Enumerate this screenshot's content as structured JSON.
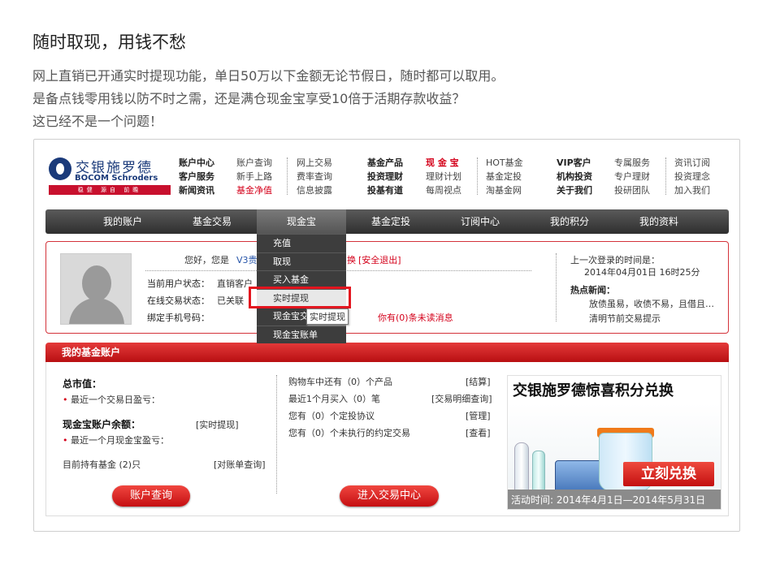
{
  "intro": {
    "title": "随时取现，用钱不愁",
    "lines": [
      "网上直销已开通实时提现功能，单日50万以下金额无论节假日，随时都可以取用。",
      "是备点钱零用钱以防不时之需，还是满仓现金宝享受10倍于活期存款收益？",
      "这已经不是一个问题！"
    ]
  },
  "logo": {
    "cn": "交银施罗德",
    "en": "BOCOM Schroders",
    "slogan": "稳健 源自 前瞻"
  },
  "header_links": {
    "col1": [
      "账户中心",
      "客户服务",
      "新闻资讯"
    ],
    "col2": [
      "账户查询",
      "新手上路",
      "基金净值"
    ],
    "col3": [
      "网上交易",
      "费率查询",
      "信息披露"
    ],
    "col4": [
      "基金产品",
      "投资理财",
      "投基有道"
    ],
    "col5": [
      "现 金 宝",
      "理财计划",
      "每周视点"
    ],
    "col6": [
      "HOT基金",
      "基金定投",
      "淘基金网"
    ],
    "col7": [
      "VIP客户",
      "机构投资",
      "关于我们"
    ],
    "col8": [
      "专属服务",
      "专户理财",
      "投研团队"
    ],
    "col9": [
      "资讯订阅",
      "投资理念",
      "加入我们"
    ]
  },
  "nav": [
    "我的账户",
    "基金交易",
    "现金宝",
    "基金定投",
    "订阅中心",
    "我的积分",
    "我的资料"
  ],
  "dropdown": [
    "充值",
    "取现",
    "买入基金",
    "实时提现",
    "现金宝交",
    "现金宝账单"
  ],
  "tooltip": "实时提现",
  "account": {
    "greeting": "您好，您是",
    "vip": "V3贵宾客",
    "hidden_suffix": "换",
    "logout": "[安全退出]",
    "status_label": "当前用户状态：",
    "status_value": "直销客户",
    "trade_label": "在线交易状态：",
    "trade_value": "已关联",
    "phone_label": "绑定手机号码：",
    "unread": "你有(0)条未读消息",
    "last_login_label": "上一次登录的时间是：",
    "last_login_time": "2014年04月01日 16时25分",
    "news_label": "热点新闻：",
    "news": [
      "放债虽易，收债不易，且借且…",
      "清明节前交易提示"
    ]
  },
  "fund": {
    "header": "我的基金账户",
    "total_label": "总市值：",
    "total_sub": "最近一个交易日盈亏：",
    "cash_label": "现金宝账户余额：",
    "cash_link": "[实时提现]",
    "cash_sub": "最近一个月现金宝盈亏：",
    "holding": "目前持有基金 (2)只",
    "holding_link": "[对账单查询]",
    "rows": [
      {
        "text": "购物车中还有（0）个产品",
        "link": "[结算]"
      },
      {
        "text": "最近1个月买入（0）笔",
        "link": "[交易明细查询]"
      },
      {
        "text": "您有（0）个定投协议",
        "link": "[管理]"
      },
      {
        "text": "您有（0）个未执行的约定交易",
        "link": "[查看]"
      }
    ],
    "btn_query": "账户查询",
    "btn_trade": "进入交易中心"
  },
  "promo": {
    "title": "交银施罗德惊喜积分兑换",
    "button": "立刻兑换",
    "date": "活动时间: 2014年4月1日—2014年5月31日"
  },
  "colors": {
    "accent": "#d4001a",
    "nav": "#3a3a3a",
    "brand": "#1a3a7a"
  }
}
